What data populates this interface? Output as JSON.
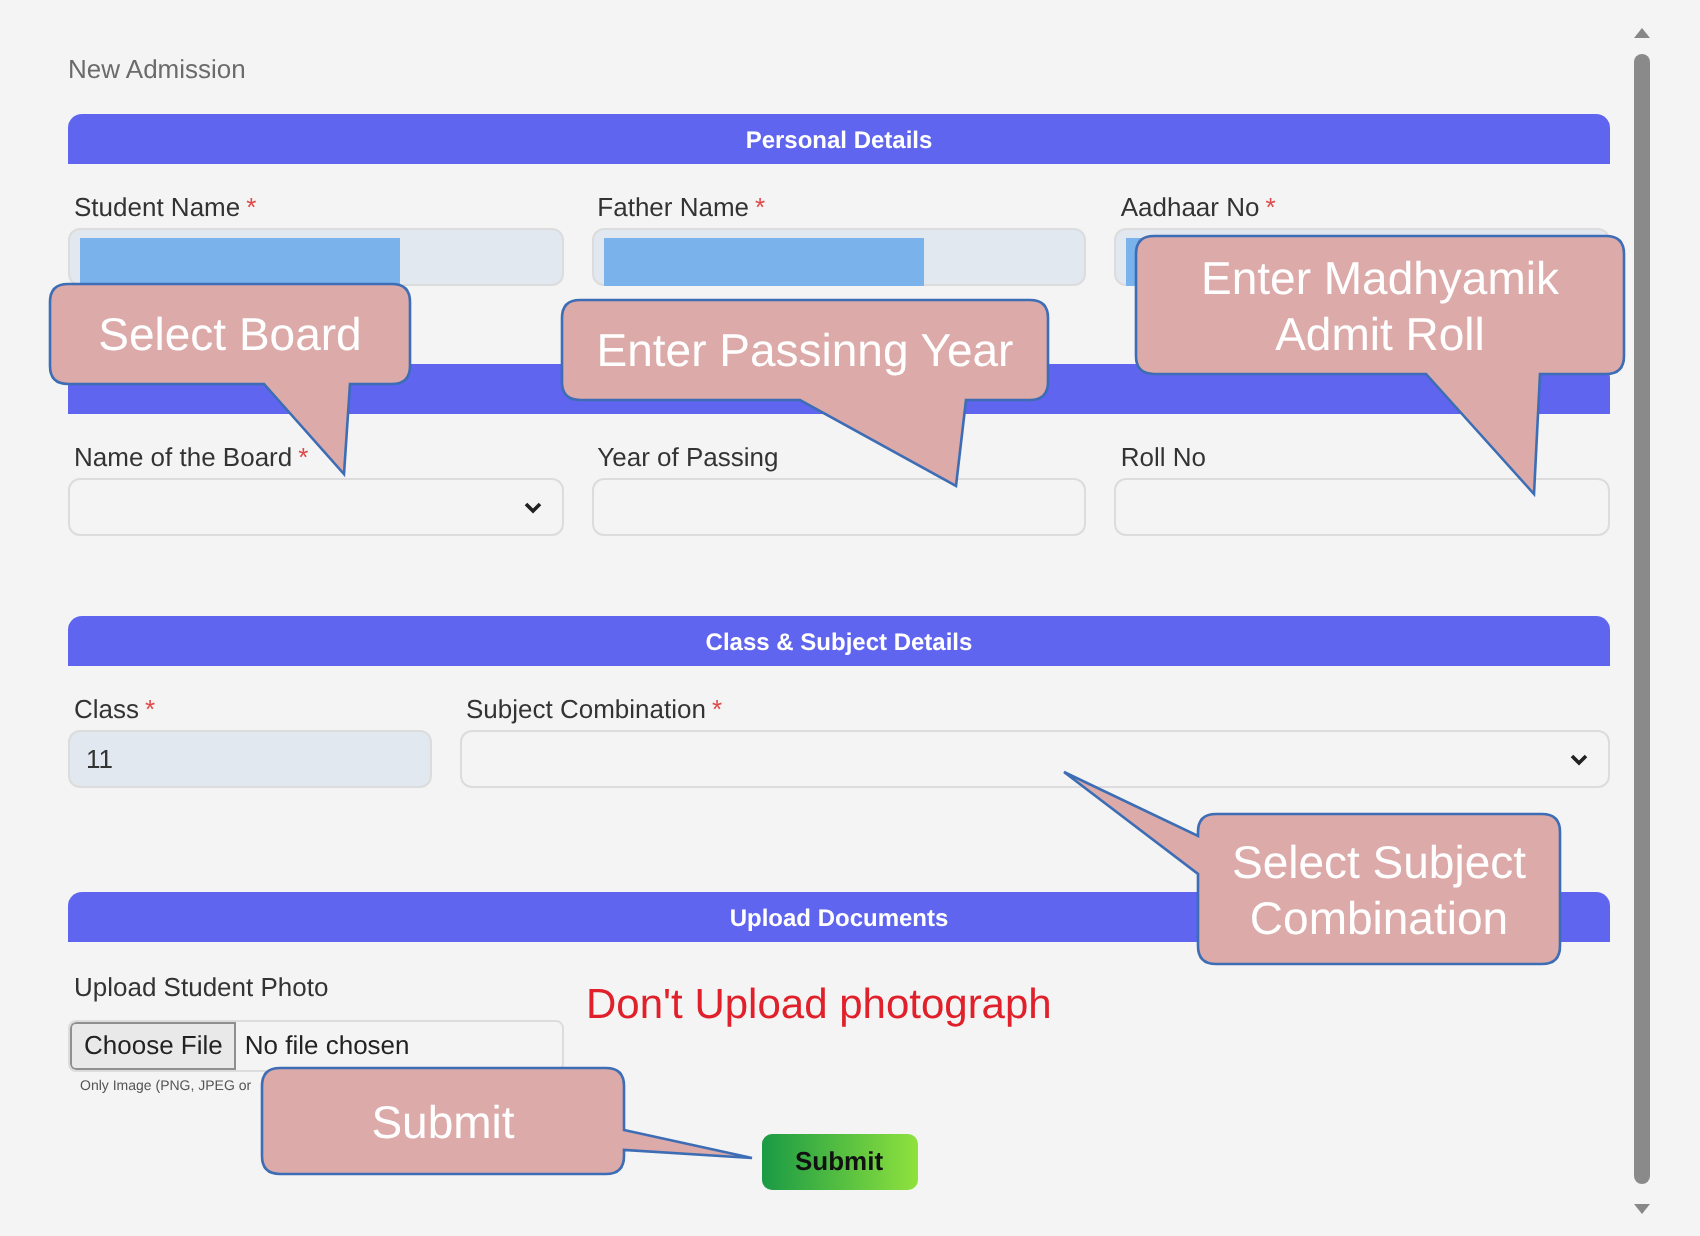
{
  "page_title": "New Admission",
  "sections": [
    {
      "title": "Personal Details",
      "fields": [
        {
          "kind": "text",
          "label": "Student Name",
          "required_mark": "*",
          "readonly": true,
          "redacted": true
        },
        {
          "kind": "text",
          "label": "Father Name",
          "required_mark": "*",
          "readonly": true,
          "redacted": true
        },
        {
          "kind": "text",
          "label": "Aadhaar No",
          "required_mark": "*",
          "readonly": true,
          "redacted": true
        }
      ]
    },
    {
      "fields": [
        {
          "kind": "select",
          "label": "Name of the Board",
          "required_mark": "*"
        },
        {
          "kind": "text",
          "label": "Year of Passing",
          "readonly": false,
          "redacted": false
        },
        {
          "kind": "text",
          "label": "Roll No",
          "readonly": false,
          "redacted": false
        }
      ]
    },
    {
      "title": "Class & Subject Details",
      "fields": [
        {
          "kind": "text",
          "label": "Class",
          "required_mark": "*",
          "readonly": true,
          "redacted": false,
          "value": "11"
        },
        {
          "kind": "select",
          "label": "Subject Combination",
          "required_mark": "*"
        }
      ]
    },
    {
      "title": "Upload Documents",
      "fields": [
        {
          "kind": "file",
          "label": "Upload Student Photo",
          "button": "Choose File",
          "status": "No file chosen",
          "help": "Only Image (PNG, JPEG or"
        }
      ],
      "note": "Don't Upload photograph"
    }
  ],
  "submit": "Submit",
  "callouts": [
    {
      "text": "Select Board"
    },
    {
      "text": "Enter Passinng Year"
    },
    {
      "text": "Enter Madhyamik Admit Roll"
    },
    {
      "text": "Select Subject Combination"
    },
    {
      "text": "Submit"
    }
  ]
}
